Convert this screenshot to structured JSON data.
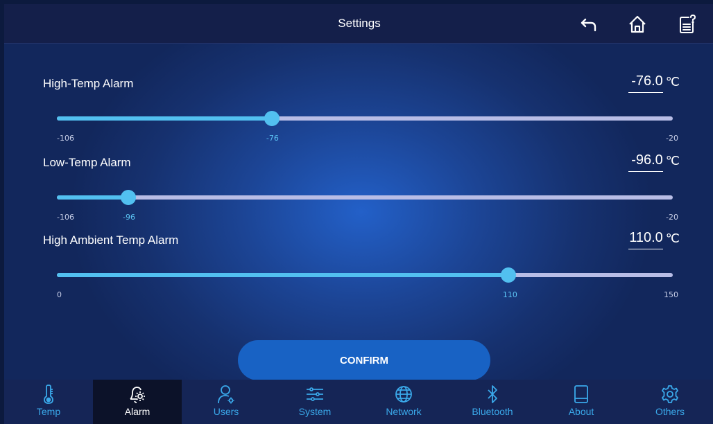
{
  "header": {
    "title": "Settings",
    "icons": [
      "back-arrow-icon",
      "home-icon",
      "clipboard-help-icon"
    ]
  },
  "settings": [
    {
      "label": "High-Temp Alarm",
      "value": "-76.0",
      "unit": "℃",
      "min": "-106",
      "max": "-20",
      "current": "-76",
      "fraction": 0.349
    },
    {
      "label": "Low-Temp Alarm",
      "value": "-96.0",
      "unit": "℃",
      "min": "-106",
      "max": "-20",
      "current": "-96",
      "fraction": 0.116
    },
    {
      "label": "High Ambient Temp Alarm",
      "value": "110.0",
      "unit": "℃",
      "min": "0",
      "max": "150",
      "current": "110",
      "fraction": 0.733
    }
  ],
  "confirm_label": "CONFIRM",
  "nav": [
    {
      "label": "Temp",
      "icon": "thermometer-icon",
      "active": false
    },
    {
      "label": "Alarm",
      "icon": "alarm-bell-gear-icon",
      "active": true
    },
    {
      "label": "Users",
      "icon": "user-gear-icon",
      "active": false
    },
    {
      "label": "System",
      "icon": "sliders-icon",
      "active": false
    },
    {
      "label": "Network",
      "icon": "globe-icon",
      "active": false
    },
    {
      "label": "Bluetooth",
      "icon": "bluetooth-icon",
      "active": false
    },
    {
      "label": "About",
      "icon": "tablet-icon",
      "active": false
    },
    {
      "label": "Others",
      "icon": "gear-icon",
      "active": false
    }
  ],
  "colors": {
    "accent": "#52c0f0",
    "track": "#b8bde6",
    "header": "#141f4a",
    "nav": "#152556",
    "nav_active": "#0c1229",
    "button": "#1862c4"
  }
}
